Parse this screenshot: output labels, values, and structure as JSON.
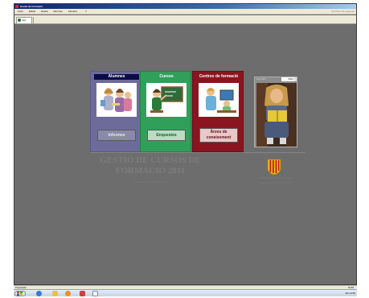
{
  "window": {
    "title": "Gestió de Formació",
    "menu": [
      "Arxiu",
      "Edició",
      "Gestió",
      "Informes",
      "Finestra",
      "?"
    ],
    "help_placeholder": "Escriba una pregunta",
    "tab_label": "Inici"
  },
  "panels": [
    {
      "header": "Alumnes",
      "button": "Informes"
    },
    {
      "header": "Cursos",
      "button": "Enquestes"
    },
    {
      "header": "Centres de formació",
      "button": "Àrees de coneixement"
    }
  ],
  "year_selector": {
    "label": "Any ACT.",
    "value": "2011"
  },
  "main_title": "GESTIÓ DE CURSOS DE FORMACIÓ 2011",
  "subtitle": "Formació en l'Empresa",
  "gov_line1": "GENERALITAT DE CATALUNYA",
  "gov_line2": "Departament de Presidència",
  "status": {
    "left": "Preparado",
    "right": "NUM"
  },
  "tray": "ES  14:55",
  "colors": {
    "background": "#6d6d6d",
    "alumnes": "#6d6b9a",
    "cursos": "#2f9f5a",
    "centres": "#8a1420"
  }
}
